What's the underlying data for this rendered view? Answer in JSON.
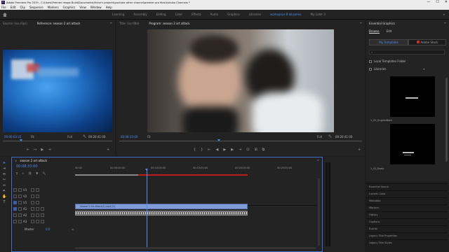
{
  "titlebar": {
    "title": "Adobe Premiere Pro 2019 - C:\\Users\\Premier Image Build\\Documents\\Victor's projects\\youtube other channel\\premier pro files\\hukuba Channels *",
    "minimize": "—",
    "maximize": "☐",
    "close": "✕"
  },
  "menu": [
    "File",
    "Edit",
    "Clip",
    "Sequence",
    "Markers",
    "Graphics",
    "View",
    "Window",
    "Help"
  ],
  "workspaces": {
    "tabs": [
      "Learning",
      "Assembly",
      "Editing",
      "Color",
      "Effects",
      "Audio",
      "Graphics",
      "Libraries",
      "workspace 8 all.panes",
      "My Color 3"
    ],
    "active_index": 8
  },
  "source": {
    "tabs": [
      "Source: (no clips)",
      "Reference: season 2 art attack",
      "Lumetri Scopes"
    ],
    "active_index": 1,
    "timecode": "00:00:03:22",
    "fit": "Fit",
    "duration": "00:20:41:00",
    "full": "Full"
  },
  "program": {
    "tabs": [
      "Title: (no title)",
      "Program: season 2 art attack"
    ],
    "active_index": 1,
    "timecode": "00:08:33:00",
    "fit": "Fit",
    "full": "Full",
    "duration": "00:20:41:00"
  },
  "essential": {
    "title": "Essential Graphics",
    "tabs": [
      "Browse",
      "Edit"
    ],
    "active_index": 0,
    "templates_button": "My Templates",
    "stock_button": "Adobe Stock",
    "local_templates": "Local Templates Folder",
    "libraries": "Libraries",
    "items": [
      "1_01_EnglishBold",
      "1_01_Basic"
    ]
  },
  "side_panels": [
    "Essential Sound",
    "Lumetri Color",
    "Metadata",
    "Markers",
    "History",
    "Captions",
    "Events",
    "Legacy Title Properties",
    "Legacy Title Styles"
  ],
  "timeline": {
    "tab": "season 2 art attack",
    "timecode": "00:08:33:00",
    "ruler_labels": [
      "00:00",
      "00:05:00:00",
      "00:10:00:00",
      "00:15:00:00",
      "00:20:00:00",
      "00:25:00:00"
    ],
    "tracks": [
      "V3",
      "V2",
      "V1",
      "A1",
      "A2",
      "A3"
    ],
    "master": "Master",
    "master_value": "0.0",
    "clip_label": "Season 2 Art Attack(1).mp4 [V]"
  },
  "colors": {
    "accent": "#4d8ef7",
    "clip_video": "#7e9bd8",
    "clip_audio": "#6b6b6b",
    "work_area": "#c21b1b"
  }
}
